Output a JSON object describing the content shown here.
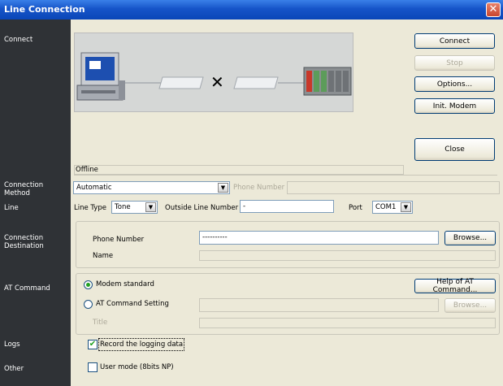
{
  "window": {
    "title": "Line Connection"
  },
  "sidebar": {
    "connect": "Connect",
    "connection_method": "Connection Method",
    "line": "Line",
    "connection_destination": "Connection Destination",
    "at_command": "AT Command",
    "logs": "Logs",
    "other": "Other"
  },
  "buttons": {
    "connect": "Connect",
    "stop": "Stop",
    "options": "Options...",
    "init_modem": "Init. Modem",
    "close": "Close",
    "browse_phone": "Browse...",
    "help_at": "Help of AT Command...",
    "browse_at": "Browse..."
  },
  "status": {
    "text": "Offline"
  },
  "connection_method": {
    "value": "Automatic",
    "phone_number_label": "Phone Number",
    "phone_number_value": ""
  },
  "line": {
    "line_type_label": "Line Type",
    "line_type_value": "Tone",
    "outside_line_label": "Outside Line Number",
    "outside_line_value": "-",
    "port_label": "Port",
    "port_value": "COM1"
  },
  "destination": {
    "phone_label": "Phone Number",
    "phone_value": "----------",
    "name_label": "Name",
    "name_value": ""
  },
  "at_command": {
    "modem_standard": "Modem standard",
    "at_setting": "AT Command Setting",
    "title_label": "Title",
    "selected": "modem_standard"
  },
  "logs": {
    "record_label": "Record the logging data",
    "checked": true
  },
  "other": {
    "user_mode_label": "User mode (8bits NP)",
    "checked": false
  },
  "colors": {
    "sidebar": "#2f3236",
    "titlebar": "#0a46b8",
    "panel": "#ece9d8"
  }
}
